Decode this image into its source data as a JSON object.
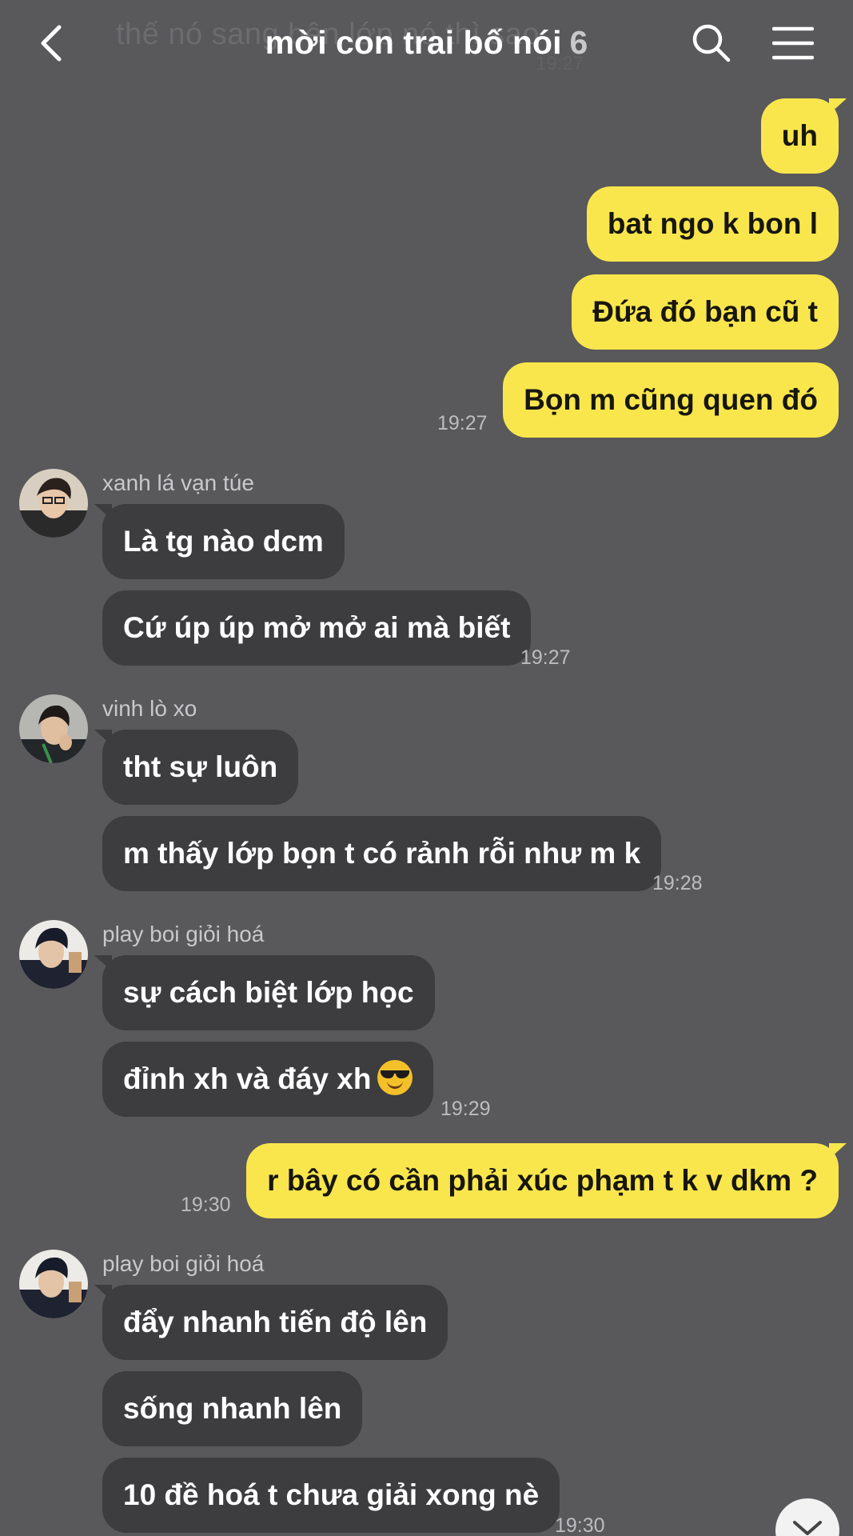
{
  "header": {
    "title": "mời con trai bố nói",
    "member_count": "6",
    "ghost_preview": "thế nó sang bên lớp nó thì sao",
    "ghost_time": "19:27"
  },
  "messages": {
    "m1": "uh",
    "m2": "bat ngo k bon l",
    "m3": "Đứa đó bạn cũ t",
    "m4": "Bọn m cũng quen đó",
    "t1": "19:27",
    "s1": "xanh lá vạn túe",
    "m5": "Là tg nào dcm",
    "m6": "Cứ úp úp mở mở ai mà biết",
    "t2": "19:27",
    "s2": "vinh lò xo",
    "m7": "tht sự luôn",
    "m8": "m thấy lớp bọn t có rảnh rỗi như m k",
    "t3": "19:28",
    "s3": "play boi giỏi hoá",
    "m9": "sự cách biệt lớp học",
    "m10": "đỉnh xh và đáy xh",
    "t4": "19:29",
    "m11": "r bây có cần phải xúc phạm t k v dkm ?",
    "t5": "19:30",
    "s4": "play boi giỏi hoá",
    "m12": "đẩy nhanh tiến độ lên",
    "m13": "sống nhanh lên",
    "m14": "10 đề hoá t chưa giải xong nè",
    "t6": "19:30"
  },
  "icons": {
    "back": "chevron-left-icon",
    "search": "search-icon",
    "menu": "hamburger-menu-icon",
    "emoji": "sunglasses-emoji-icon",
    "scroll": "chevron-down-icon"
  },
  "colors": {
    "background": "#59585b",
    "my_bubble": "#f9e64d",
    "their_bubble": "#3d3c3f",
    "timestamp": "#bdbcbf"
  }
}
